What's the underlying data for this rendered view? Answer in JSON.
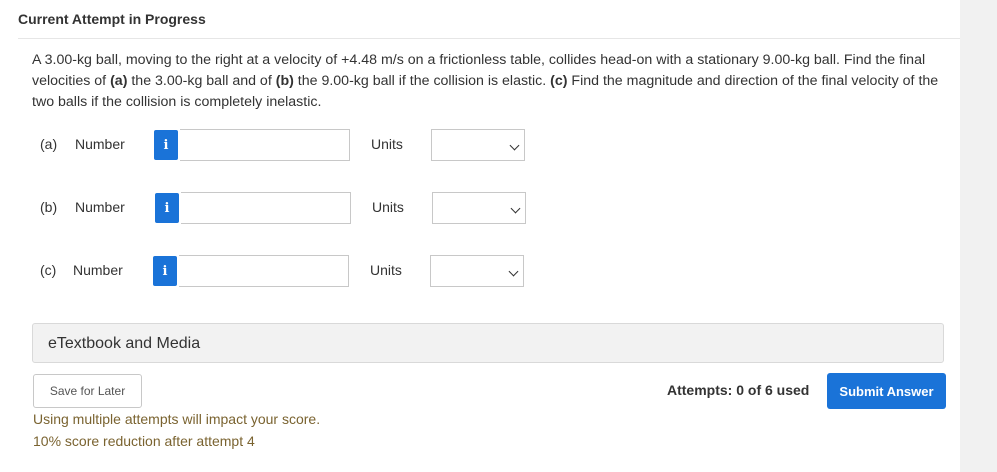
{
  "header": {
    "title": "Current Attempt in Progress"
  },
  "question": {
    "t1": "A 3.00-kg ball, moving to the right at a velocity of +4.48 m/s on a frictionless table, collides head-on with a stationary 9.00-kg ball. Find the final velocities of ",
    "a_label": "(a)",
    "t2": " the 3.00-kg ball and of ",
    "b_label": "(b)",
    "t3": " the 9.00-kg ball if the collision is elastic. ",
    "c_label": "(c)",
    "t4": " Find the magnitude and direction of the final velocity of the two balls if the collision is completely inelastic."
  },
  "parts": [
    {
      "label": "(a)",
      "number_label": "Number",
      "info": "i",
      "value": "",
      "units_label": "Units",
      "units_value": ""
    },
    {
      "label": "(b)",
      "number_label": "Number",
      "info": "i",
      "value": "",
      "units_label": "Units",
      "units_value": ""
    },
    {
      "label": "(c)",
      "number_label": "Number",
      "info": "i",
      "value": "",
      "units_label": "Units",
      "units_value": ""
    }
  ],
  "etextbook": {
    "label": "eTextbook and Media"
  },
  "footer": {
    "save_label": "Save for Later",
    "attempts_text": "Attempts: 0 of 6 used",
    "submit_label": "Submit Answer",
    "warning_1": "Using multiple attempts will impact your score.",
    "warning_2": "10% score reduction after attempt 4"
  },
  "colors": {
    "accent": "#1a73d8",
    "warning_text": "#7a6330"
  },
  "icons": {
    "info": "info-icon",
    "dropdown": "chevron-down-icon"
  }
}
